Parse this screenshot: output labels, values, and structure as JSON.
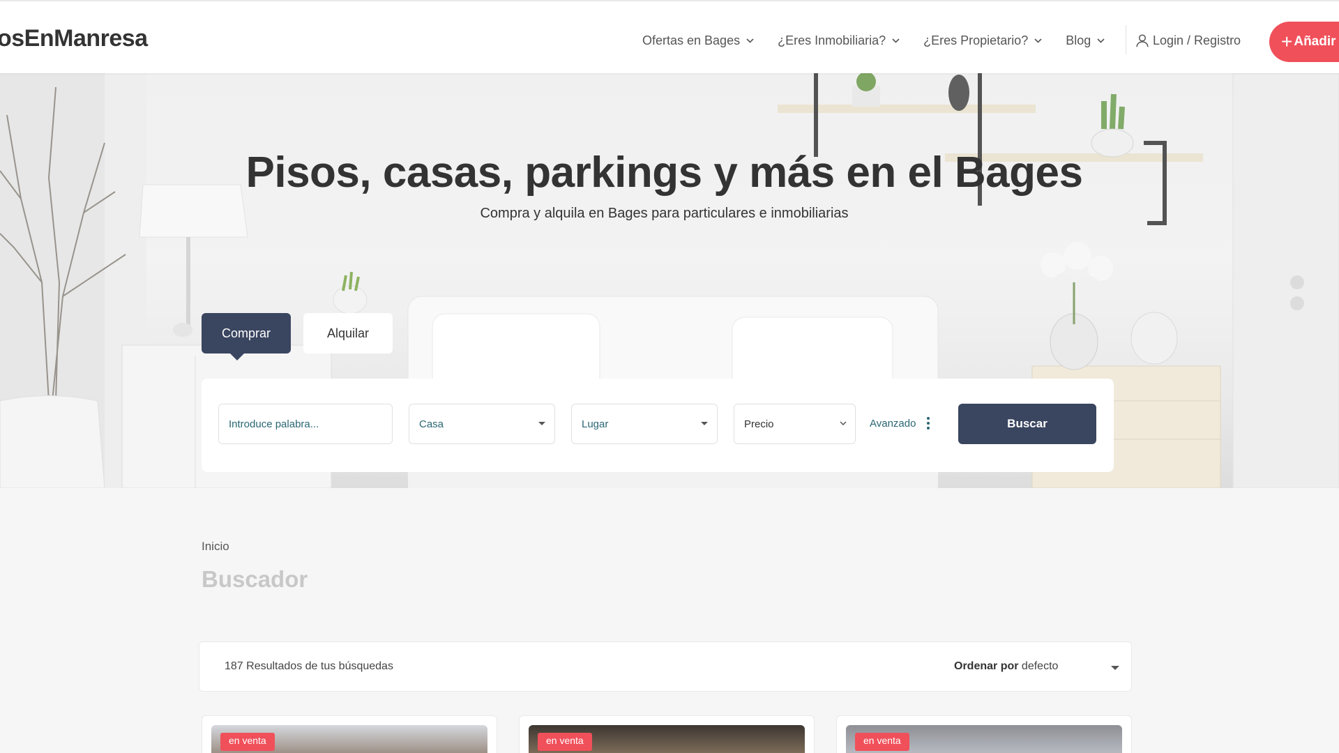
{
  "header": {
    "logo": "osEnManresa",
    "nav": [
      {
        "label": "Ofertas en Bages"
      },
      {
        "label": "¿Eres Inmobiliaria?"
      },
      {
        "label": "¿Eres Propietario?"
      },
      {
        "label": "Blog"
      }
    ],
    "login_label": "Login / Registro",
    "add_label": "Añadir"
  },
  "hero": {
    "title": "Pisos, casas, parkings y más en el Bages",
    "subtitle": "Compra y alquila en Bages para particulares e inmobiliarias",
    "tabs": [
      {
        "label": "Comprar",
        "active": true
      },
      {
        "label": "Alquilar",
        "active": false
      }
    ],
    "search": {
      "keyword_placeholder": "Introduce palabra...",
      "type_value": "Casa",
      "place_value": "Lugar",
      "price_value": "Precio",
      "advanced_label": "Avanzado",
      "search_button": "Buscar"
    }
  },
  "main": {
    "breadcrumb": "Inicio",
    "page_title": "Buscador",
    "results_count": "187 Resultados de tus búsquedas",
    "sort_label": "Ordenar por",
    "sort_value": "defecto",
    "cards": [
      {
        "badge": "en venta"
      },
      {
        "badge": "en venta"
      },
      {
        "badge": "en venta"
      }
    ]
  },
  "colors": {
    "accent_red": "#f0505a",
    "primary_navy": "#3a4560",
    "link_teal": "#2a6673"
  },
  "icons": [
    "chevron-down-icon",
    "user-icon",
    "plus-icon",
    "more-vertical-icon",
    "caret-down-icon"
  ]
}
